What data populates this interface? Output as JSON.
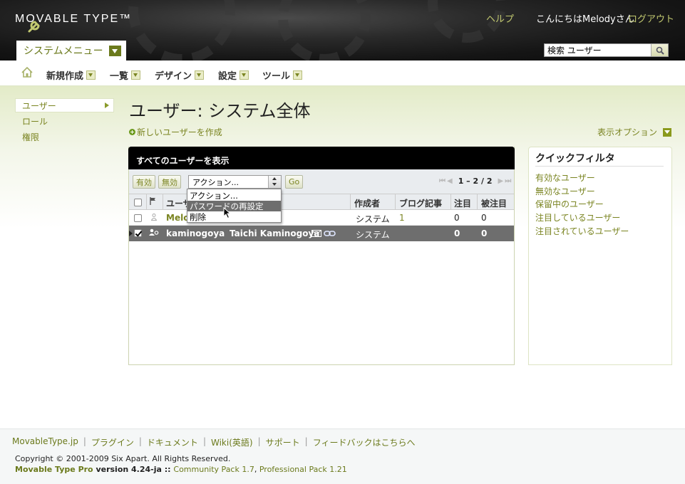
{
  "header": {
    "logo_text": "MOVABLE TYPE™",
    "help": "ヘルプ",
    "greeting": "こんにちはMelodyさん",
    "logout": "ログアウト",
    "system_menu": "システムメニュー",
    "search_value": "検索 ユーザー"
  },
  "nav": {
    "items": [
      "新規作成",
      "一覧",
      "デザイン",
      "設定",
      "ツール"
    ]
  },
  "sidebar": {
    "items": [
      "ユーザー",
      "ロール",
      "権限"
    ]
  },
  "main": {
    "title": "ユーザー: システム全体",
    "create_user": "新しいユーザーを作成",
    "display_options": "表示オプション"
  },
  "listing": {
    "header": "すべてのユーザーを表示",
    "btn_enable": "有効",
    "btn_disable": "無効",
    "action_select": "アクション...",
    "go": "Go",
    "pager": "1 – 2 / 2",
    "columns": [
      "ユーザー名",
      "作成者",
      "ブログ記事",
      "注目",
      "被注目"
    ],
    "column_user_visible": "ユーザ",
    "rows": [
      {
        "username": "Melo",
        "display_name": "",
        "created_by": "システム",
        "entries": "1",
        "following": "0",
        "followers": "0",
        "selected": false
      },
      {
        "username": "kaminogoya",
        "display_name": "Taichi Kaminogoya",
        "created_by": "システム",
        "entries": "",
        "following": "0",
        "followers": "0",
        "selected": true
      }
    ],
    "action_menu": [
      "アクション...",
      "パスワードの再設定",
      "削除"
    ]
  },
  "quick_filter": {
    "title": "クイックフィルタ",
    "links": [
      "有効なユーザー",
      "無効なユーザー",
      "保留中のユーザー",
      "注目しているユーザー",
      "注目されているユーザー"
    ]
  },
  "footer": {
    "links": [
      "MovableType.jp",
      "プラグイン",
      "ドキュメント",
      "Wiki(英語)",
      "サポート",
      "フィードバックはこちらへ"
    ],
    "copyright": "Copyright © 2001-2009 Six Apart. All Rights Reserved.",
    "product": "Movable Type Pro",
    "version": " version 4.24-ja :: ",
    "community_pack": "Community Pack 1.7",
    "comma": ", ",
    "professional_pack": "Professional Pack 1.21"
  },
  "colors": {
    "accent_olive": "#7a8421",
    "header_bg": "#151515",
    "selected_row": "#6e6e6e"
  }
}
